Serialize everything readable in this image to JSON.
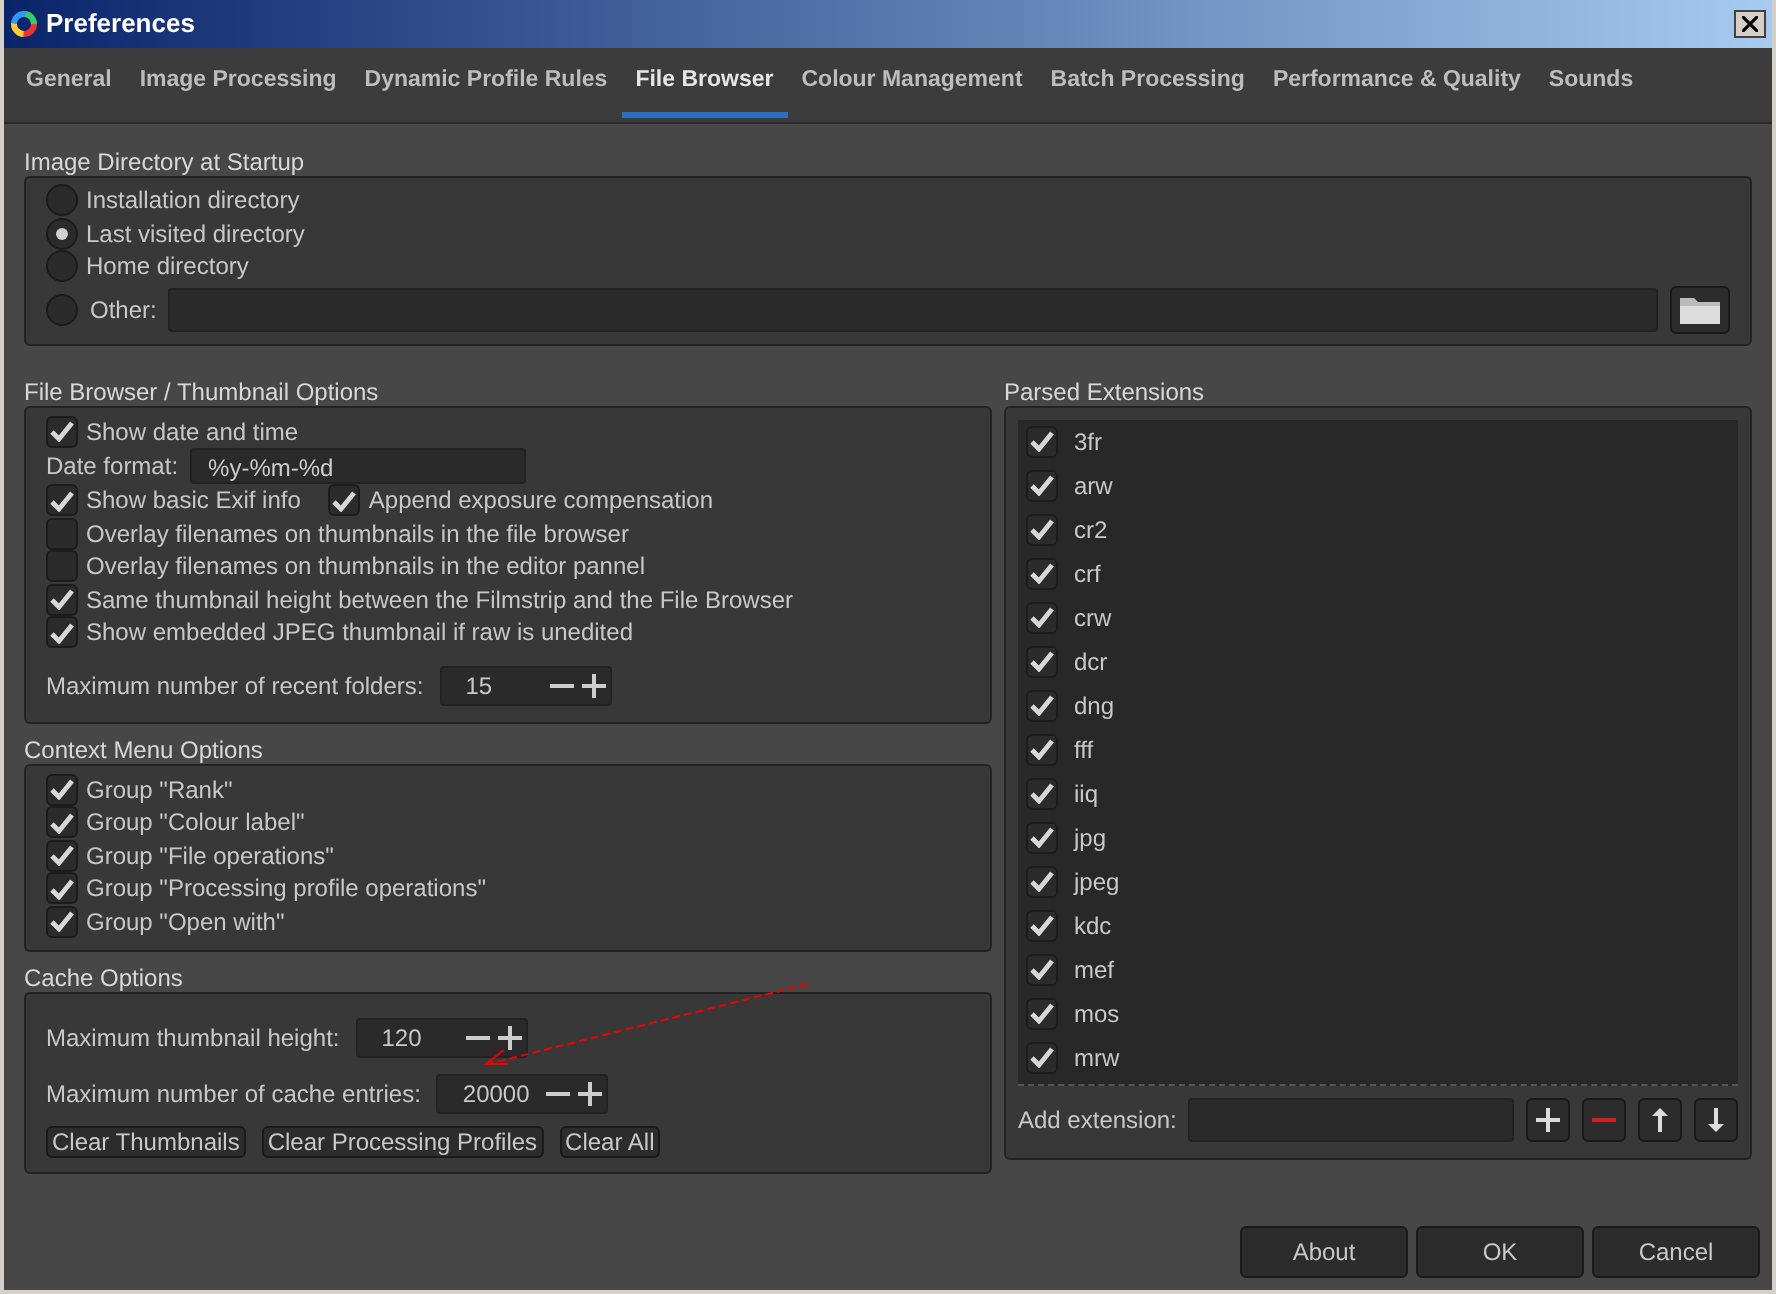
{
  "window": {
    "title": "Preferences"
  },
  "tabs": [
    {
      "label": "General",
      "selected": false
    },
    {
      "label": "Image Processing",
      "selected": false
    },
    {
      "label": "Dynamic Profile Rules",
      "selected": false
    },
    {
      "label": "File Browser",
      "selected": true
    },
    {
      "label": "Colour Management",
      "selected": false
    },
    {
      "label": "Batch Processing",
      "selected": false
    },
    {
      "label": "Performance & Quality",
      "selected": false
    },
    {
      "label": "Sounds",
      "selected": false
    }
  ],
  "startup": {
    "title": "Image Directory at Startup",
    "options": [
      {
        "kind": "radio",
        "label": "Installation directory",
        "selected": false
      },
      {
        "kind": "radio",
        "label": "Last visited directory",
        "selected": true
      },
      {
        "kind": "radio",
        "label": "Home directory",
        "selected": false
      },
      {
        "kind": "radio_field",
        "label": "Other:",
        "selected": false
      }
    ]
  },
  "thumbnail_options": {
    "title": "File Browser / Thumbnail Options",
    "rows": [
      {
        "kind": "checkbox",
        "label": "Show date and time",
        "checked": true
      },
      {
        "kind": "field",
        "label": "Date format:",
        "value": "%y-%m-%d"
      },
      {
        "kind": "checkbox_pair",
        "items": [
          {
            "label": "Show basic Exif info",
            "checked": true
          },
          {
            "label": "Append exposure compensation",
            "checked": true
          }
        ]
      },
      {
        "kind": "checkbox",
        "label": "Overlay filenames on thumbnails in the file browser",
        "checked": false
      },
      {
        "kind": "checkbox",
        "label": "Overlay filenames on thumbnails in the editor pannel",
        "checked": false
      },
      {
        "kind": "checkbox",
        "label": "Same thumbnail height between the Filmstrip and the File Browser",
        "checked": true
      },
      {
        "kind": "checkbox",
        "label": "Show embedded JPEG thumbnail if raw is unedited",
        "checked": true
      },
      {
        "kind": "spin",
        "label": "Maximum number of recent folders:",
        "value": "15"
      }
    ]
  },
  "context_menu": {
    "title": "Context Menu Options",
    "items": [
      {
        "label": "Group \"Rank\"",
        "checked": true
      },
      {
        "label": "Group \"Colour label\"",
        "checked": true
      },
      {
        "label": "Group \"File operations\"",
        "checked": true
      },
      {
        "label": "Group \"Processing profile operations\"",
        "checked": true
      },
      {
        "label": "Group \"Open with\"",
        "checked": true
      }
    ]
  },
  "cache": {
    "title": "Cache Options",
    "rows": [
      {
        "kind": "spin",
        "label": "Maximum thumbnail height:",
        "value": "120"
      },
      {
        "kind": "spin",
        "label": "Maximum number of cache entries:",
        "value": "20000"
      }
    ],
    "buttons": [
      "Clear Thumbnails",
      "Clear Processing Profiles",
      "Clear All"
    ]
  },
  "extensions": {
    "title": "Parsed Extensions",
    "items": [
      {
        "label": "3fr",
        "checked": true
      },
      {
        "label": "arw",
        "checked": true
      },
      {
        "label": "cr2",
        "checked": true
      },
      {
        "label": "crf",
        "checked": true
      },
      {
        "label": "crw",
        "checked": true
      },
      {
        "label": "dcr",
        "checked": true
      },
      {
        "label": "dng",
        "checked": true
      },
      {
        "label": "fff",
        "checked": true
      },
      {
        "label": "iiq",
        "checked": true
      },
      {
        "label": "jpg",
        "checked": true
      },
      {
        "label": "jpeg",
        "checked": true
      },
      {
        "label": "kdc",
        "checked": true
      },
      {
        "label": "mef",
        "checked": true
      },
      {
        "label": "mos",
        "checked": true
      },
      {
        "label": "mrw",
        "checked": true
      }
    ],
    "add_label": "Add extension:"
  },
  "buttons": [
    "About",
    "OK",
    "Cancel"
  ]
}
